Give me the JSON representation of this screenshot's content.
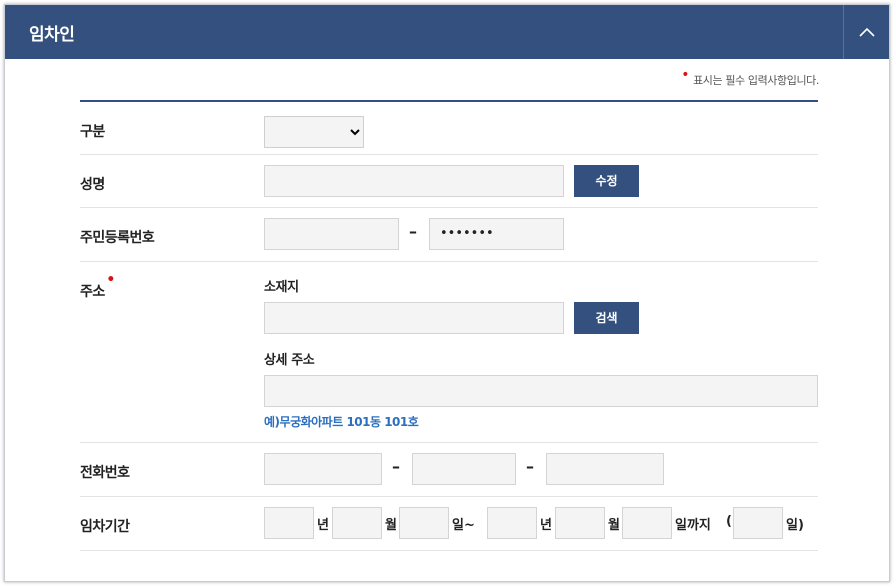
{
  "header": {
    "title": "임차인",
    "toggle_icon": "chevron-up-icon"
  },
  "note": {
    "bullet": "•",
    "text": "표시는 필수 입력사항입니다."
  },
  "rows": {
    "type": {
      "label": "구분",
      "selected": ""
    },
    "name": {
      "label": "성명",
      "value": "",
      "button": "수정"
    },
    "rrn": {
      "label": "주민등록번호",
      "front": "",
      "dash": "–",
      "back": "•••••••"
    },
    "address": {
      "label": "주소",
      "required_mark": "•",
      "location_label": "소재지",
      "location_value": "",
      "search_button": "검색",
      "detail_label": "상세 주소",
      "detail_value": "",
      "example": "예)무궁화아파트 101동 101호"
    },
    "phone": {
      "label": "전화번호",
      "part1": "",
      "part2": "",
      "part3": "",
      "dash": "–"
    },
    "period": {
      "label": "임차기간",
      "year_unit": "년",
      "month_unit": "월",
      "day_unit_tilde": "일~",
      "until_unit": "일까지",
      "open_paren": "(",
      "close_unit": "일)"
    }
  }
}
